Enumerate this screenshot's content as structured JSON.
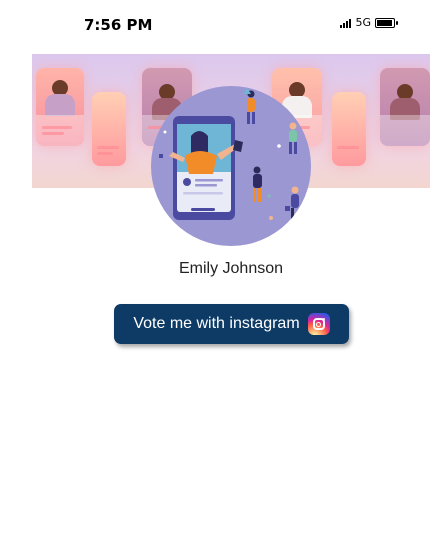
{
  "status_bar": {
    "time": "7:56 PM",
    "network": "5G",
    "icons": [
      "signal-icon",
      "battery-icon"
    ]
  },
  "banner": {
    "image": "social-media-collage-banner",
    "colors": {
      "bg_top": "#dcc8ee",
      "bg_bottom": "#f3d6d0"
    }
  },
  "profile": {
    "avatar": "social-media-influencer-illustration",
    "name": "Emily Johnson"
  },
  "vote_button": {
    "label": "Vote me with instagram",
    "icon": "instagram-icon",
    "color": "#0d3b66"
  }
}
